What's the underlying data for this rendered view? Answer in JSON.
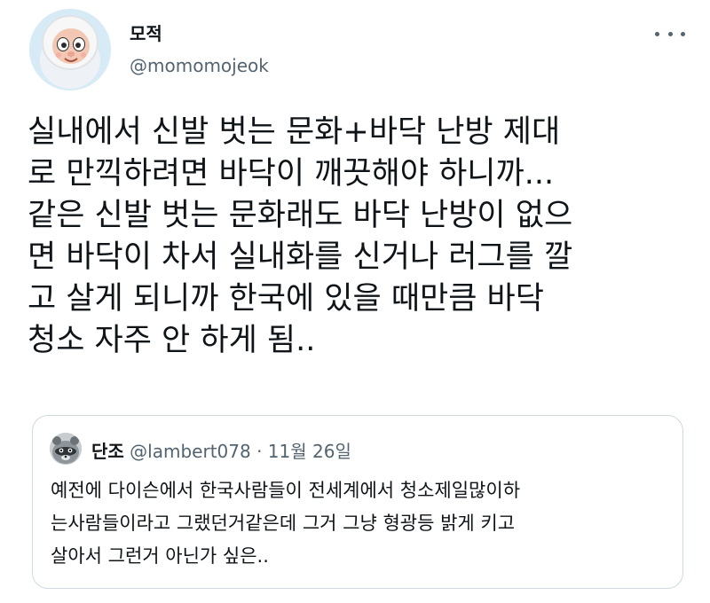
{
  "tweet": {
    "author_name": "모적",
    "author_handle": "@momomojeok",
    "text": "실내에서 신발 벗는 문화+바닥 난방 제대\n로 만끽하려면 바닥이 깨끗해야 하니까...\n같은 신발 벗는 문화래도 바닥 난방이 없으\n면 바닥이 차서 실내화를 신거나 러그를 깔\n고 살게 되니까 한국에 있을 때만큼 바닥\n청소 자주 안 하게 됨..",
    "more_icon": "more-horizontal-icon"
  },
  "quoted_tweet": {
    "author_name": "단조",
    "author_handle": "@lambert078",
    "separator": "·",
    "date": "11월 26일",
    "text": "예전에 다이슨에서 한국사람들이 전세계에서 청소제일많이하\n는사람들이라고 그랬던거같은데 그거 그냥 형광등 밝게 키고\n살아서 그런거 아닌가 싶은.."
  }
}
